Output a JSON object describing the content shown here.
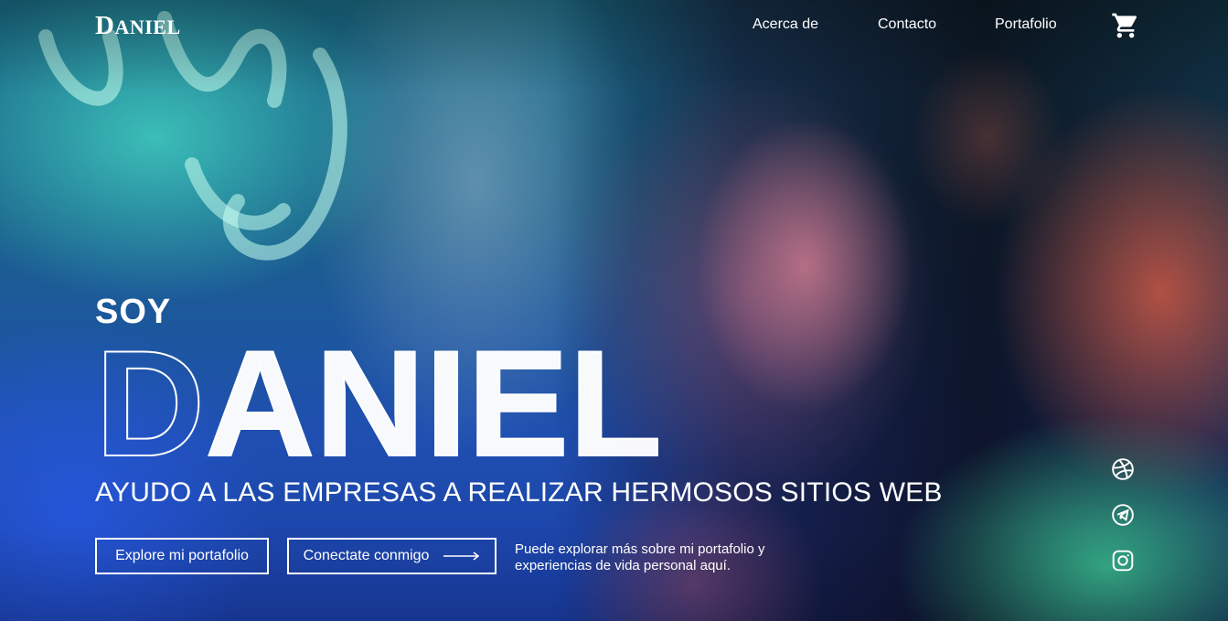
{
  "header": {
    "logo_first": "D",
    "logo_rest": "ANIEL",
    "nav": [
      {
        "label": "Acerca de"
      },
      {
        "label": "Contacto"
      },
      {
        "label": "Portafolio"
      }
    ],
    "cart_icon": "shopping-cart-icon"
  },
  "hero": {
    "intro": "SOY",
    "name": "DANIEL",
    "tagline": "AYUDO A LAS EMPRESAS A REALIZAR HERMOSOS SITIOS WEB",
    "buttons": {
      "explore": "Explore mi portafolio",
      "connect": "Conectate conmigo"
    },
    "description": "Puede explorar más sobre mi portafolio y experiencias de vida personal aquí."
  },
  "social": [
    {
      "icon": "dribbble-icon"
    },
    {
      "icon": "telegram-icon"
    },
    {
      "icon": "instagram-icon"
    }
  ],
  "colors": {
    "text": "#ffffff"
  }
}
